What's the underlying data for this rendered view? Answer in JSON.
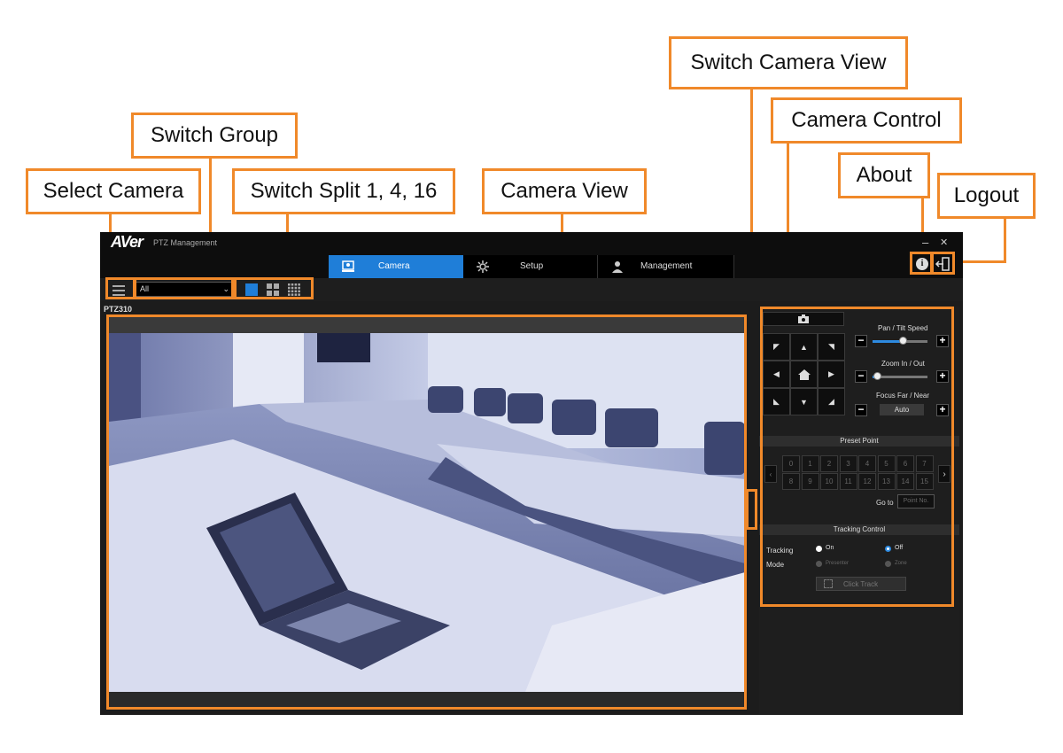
{
  "callouts": {
    "switch_camera_view": "Switch Camera View",
    "camera_control": "Camera Control",
    "switch_group": "Switch Group",
    "about": "About",
    "logout": "Logout",
    "select_camera": "Select Camera",
    "switch_split": "Switch Split 1, 4, 16",
    "camera_view": "Camera View"
  },
  "app": {
    "logo": "AVer",
    "subtitle": "PTZ Management",
    "minimize": "–",
    "close": "✕",
    "tabs": [
      {
        "label": "Camera",
        "icon": "camera-user-icon"
      },
      {
        "label": "Setup",
        "icon": "gear-icon"
      },
      {
        "label": "Management",
        "icon": "user-icon"
      }
    ],
    "group_select": "All",
    "camera_name": "PTZ310"
  },
  "control": {
    "pan_tilt_speed": "Pan / Tilt Speed",
    "zoom": "Zoom In / Out",
    "focus": "Focus Far / Near",
    "focus_value": "Auto",
    "pan_tilt_speed_level": 0.55,
    "zoom_level": 0.05,
    "preset_title": "Preset Point",
    "presets": [
      "0",
      "1",
      "2",
      "3",
      "4",
      "5",
      "6",
      "7",
      "8",
      "9",
      "10",
      "11",
      "12",
      "13",
      "14",
      "15"
    ],
    "goto_label": "Go to",
    "goto_placeholder": "Point No.",
    "tracking_title": "Tracking Control",
    "tracking_label": "Tracking",
    "mode_label": "Mode",
    "on": "On",
    "off": "Off",
    "presenter": "Presenter",
    "zone": "Zone",
    "click_track": "Click Track"
  },
  "colors": {
    "accent": "#f0892a",
    "tab_active": "#1f7ed8"
  }
}
